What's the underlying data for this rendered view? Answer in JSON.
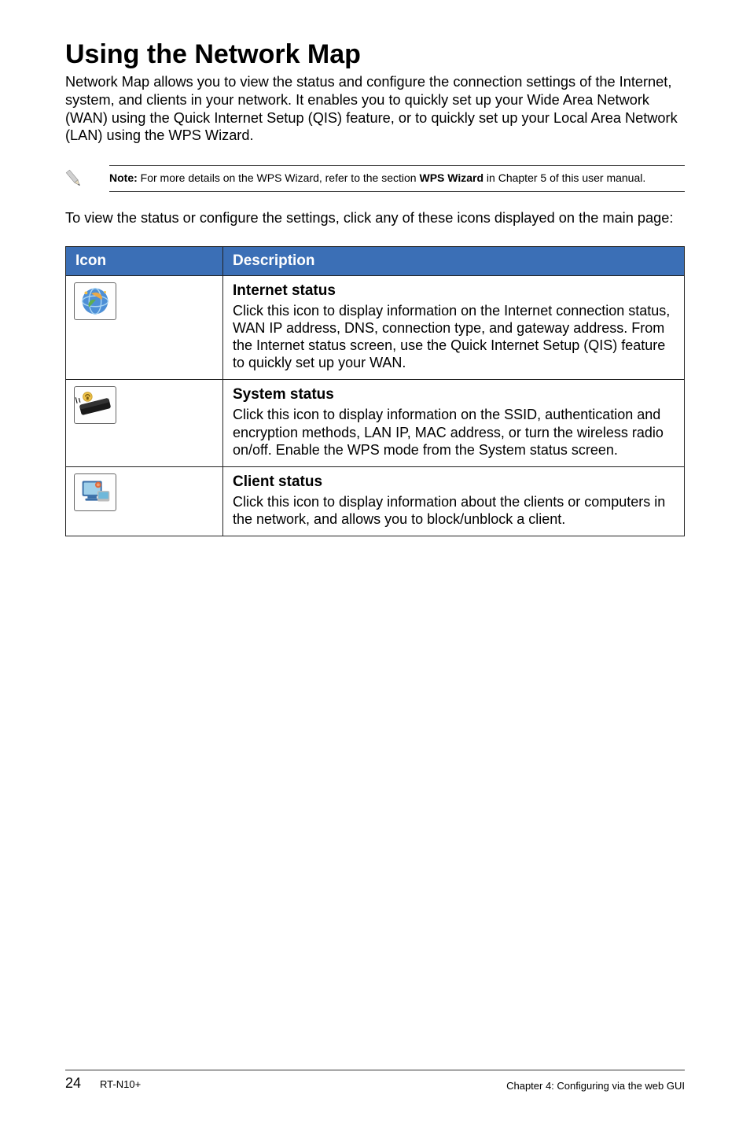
{
  "heading": "Using the Network Map",
  "intro": "Network Map allows you to view the status and configure the connection settings of the Internet, system, and clients in your network. It enables you to quickly set up your Wide Area Network (WAN) using the Quick Internet Setup (QIS) feature, or to quickly set up your Local Area Network (LAN) using the WPS Wizard.",
  "note": {
    "label": "Note:",
    "before": " For more details on the WPS Wizard, refer to the section ",
    "strong": "WPS Wizard",
    "after": " in Chapter 5 of this user manual."
  },
  "lead": "To view the status or configure the settings, click any of these icons displayed on the main page:",
  "table": {
    "headers": {
      "icon": "Icon",
      "description": "Description"
    },
    "rows": [
      {
        "icon_name": "internet-status-icon",
        "title": "Internet status",
        "body": "Click this icon to display information on the Internet connection status, WAN IP address, DNS, connection type, and gateway address. From the Internet status screen, use the Quick Internet Setup (QIS) feature to quickly set up your WAN."
      },
      {
        "icon_name": "system-status-icon",
        "title": "System status",
        "body": "Click this icon to display information on the SSID, authentication and encryption methods, LAN IP, MAC address, or turn the wireless radio on/off. Enable the WPS mode from the System status screen."
      },
      {
        "icon_name": "client-status-icon",
        "title": "Client status",
        "body": "Click this icon to display information about the clients or computers in the network, and allows you to block/unblock a client."
      }
    ]
  },
  "footer": {
    "page": "24",
    "product": "RT-N10+",
    "chapter": "Chapter 4: Configuring via the web GUI"
  }
}
